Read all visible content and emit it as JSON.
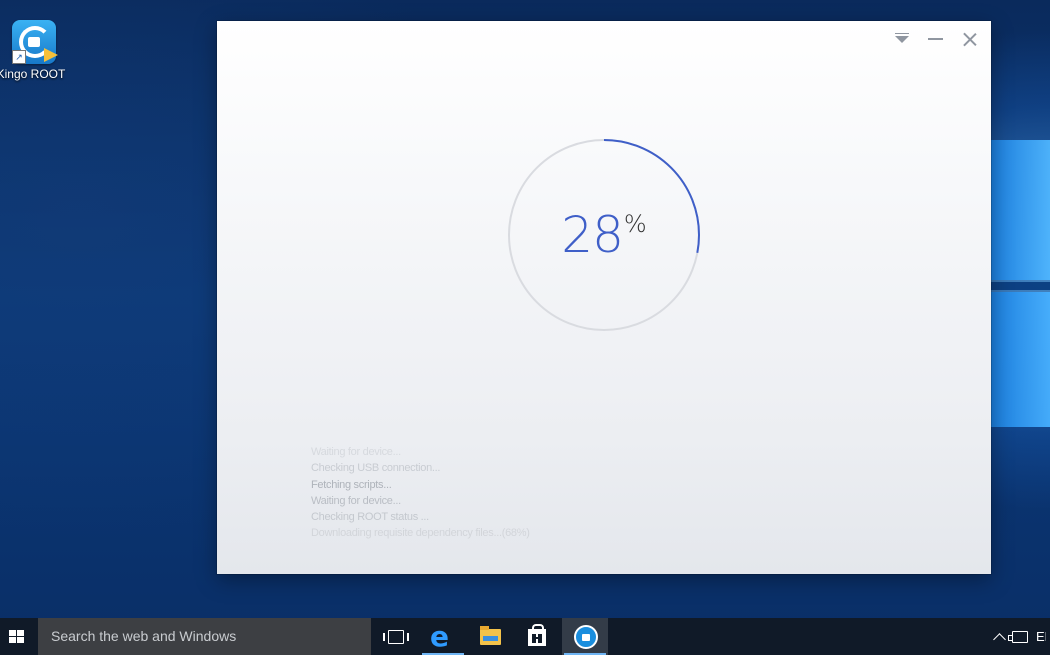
{
  "desktop": {
    "icons": [
      {
        "label": "Kingo ROOT",
        "icon": "kingo-root-app-icon"
      }
    ]
  },
  "app_window": {
    "controls": [
      {
        "name": "menu",
        "icon": "dropdown-menu-icon"
      },
      {
        "name": "minimize",
        "icon": "minimize-icon"
      },
      {
        "name": "close",
        "icon": "close-icon"
      }
    ],
    "progress": {
      "value": 28,
      "number_text": "28",
      "unit_text": "%",
      "accent_color": "#3f5fc8",
      "track_color": "#d9dbe0"
    },
    "log_lines": [
      {
        "text": "Waiting for device...",
        "color": "#d6d9de"
      },
      {
        "text": "Checking USB connection...",
        "color": "#c8ccd2"
      },
      {
        "text": "Fetching scripts...",
        "color": "#aeb3ba"
      },
      {
        "text": "Waiting for device...",
        "color": "#b9bdc4"
      },
      {
        "text": "Checking ROOT status ...",
        "color": "#c4c8ce"
      },
      {
        "text": "Downloading requisite dependency files...(68%)",
        "color": "#d2d5da"
      }
    ]
  },
  "taskbar": {
    "start_icon": "windows-start-icon",
    "search_placeholder": "Search the web and Windows",
    "apps": [
      {
        "name": "task-view",
        "icon": "task-view-icon",
        "active": false
      },
      {
        "name": "edge",
        "icon": "edge-browser-icon",
        "glyph": "e",
        "active": false
      },
      {
        "name": "file-explorer",
        "icon": "folder-icon",
        "active": false
      },
      {
        "name": "store",
        "icon": "store-icon",
        "active": false
      },
      {
        "name": "kingo-root",
        "icon": "kingo-root-app-icon",
        "active": true
      }
    ],
    "tray": {
      "icons": [
        "chevron-up-icon",
        "network-icon",
        "input-language-icon"
      ],
      "lang_glyph": "ENG"
    }
  }
}
